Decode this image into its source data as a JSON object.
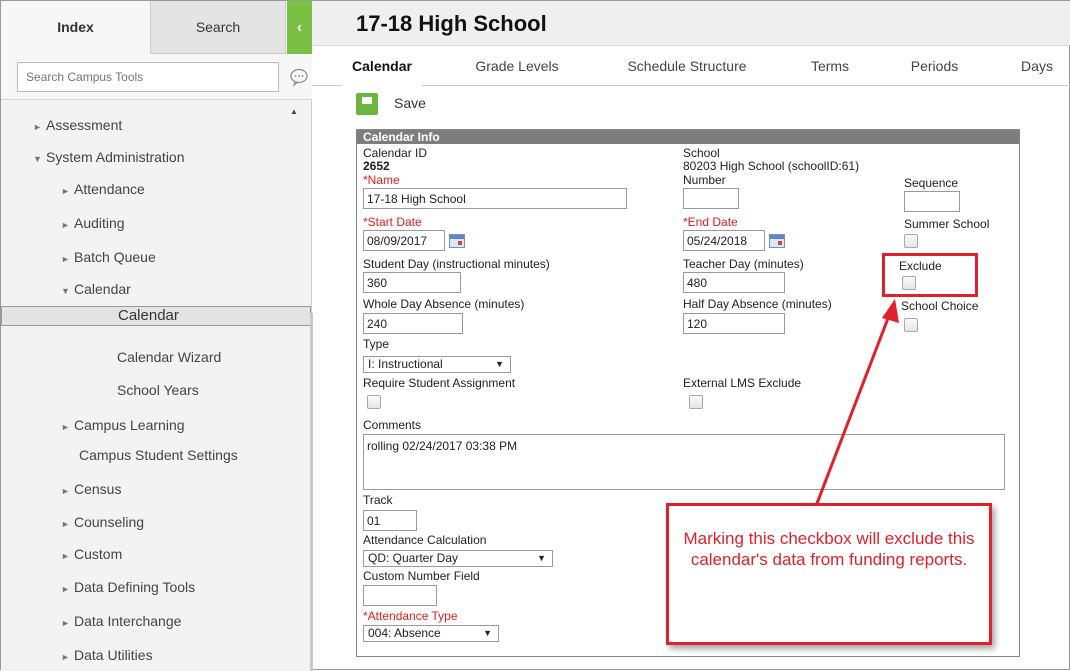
{
  "sidebar": {
    "tab_index": "Index",
    "tab_search": "Search",
    "collapse": "‹",
    "search_placeholder": "Search Campus Tools",
    "items": [
      {
        "label": "Assessment",
        "arrow": "►"
      },
      {
        "label": "System Administration",
        "arrow": "▼"
      },
      {
        "label": "Attendance",
        "arrow": "►"
      },
      {
        "label": "Auditing",
        "arrow": "►"
      },
      {
        "label": "Batch Queue",
        "arrow": "►"
      },
      {
        "label": "Calendar",
        "arrow": "▼"
      },
      {
        "label": "Calendar",
        "arrow": ""
      },
      {
        "label": "Calendar Wizard",
        "arrow": ""
      },
      {
        "label": "School Years",
        "arrow": ""
      },
      {
        "label": "Campus Learning",
        "arrow": "►"
      },
      {
        "label": "Campus Student Settings",
        "arrow": ""
      },
      {
        "label": "Census",
        "arrow": "►"
      },
      {
        "label": "Counseling",
        "arrow": "►"
      },
      {
        "label": "Custom",
        "arrow": "►"
      },
      {
        "label": "Data Defining Tools",
        "arrow": "►"
      },
      {
        "label": "Data Interchange",
        "arrow": "►"
      },
      {
        "label": "Data Utilities",
        "arrow": "►"
      }
    ]
  },
  "header": {
    "title": "17-18 High School",
    "tabs": [
      "Calendar",
      "Grade Levels",
      "Schedule Structure",
      "Terms",
      "Periods",
      "Days"
    ],
    "save_label": "Save"
  },
  "form": {
    "header": "Calendar Info",
    "calendar_id_label": "Calendar ID",
    "calendar_id": "2652",
    "school_label": "School",
    "school_value": "80203  High School (schoolID:61)",
    "name_label": "*Name",
    "name_value": "17-18 High School",
    "number_label": "Number",
    "number_value": "",
    "sequence_label": "Sequence",
    "sequence_value": "",
    "start_date_label": "*Start Date",
    "start_date": "08/09/2017",
    "end_date_label": "*End Date",
    "end_date": "05/24/2018",
    "summer_school_label": "Summer School",
    "student_day_label": "Student Day (instructional minutes)",
    "student_day": "360",
    "teacher_day_label": "Teacher Day (minutes)",
    "teacher_day": "480",
    "exclude_label": "Exclude",
    "whole_day_label": "Whole Day Absence (minutes)",
    "whole_day": "240",
    "half_day_label": "Half Day Absence (minutes)",
    "half_day": "120",
    "school_choice_label": "School Choice",
    "type_label": "Type",
    "type_value": "I: Instructional",
    "require_assignment_label": "Require Student Assignment",
    "external_lms_label": "External LMS Exclude",
    "comments_label": "Comments",
    "comments": "rolling 02/24/2017 03:38 PM",
    "track_label": "Track",
    "track": "01",
    "attendance_calc_label": "Attendance Calculation",
    "attendance_calc": "QD: Quarter Day",
    "custom_number_label": "Custom Number Field",
    "custom_number": "",
    "attendance_type_label": "*Attendance Type",
    "attendance_type": "004: Absence"
  },
  "callout": {
    "text": "Marking this checkbox will exclude this calendar's data from funding reports."
  },
  "colors": {
    "accent_green": "#7ac143",
    "required_red": "#e21c1c",
    "callout_red": "#e0202a"
  }
}
